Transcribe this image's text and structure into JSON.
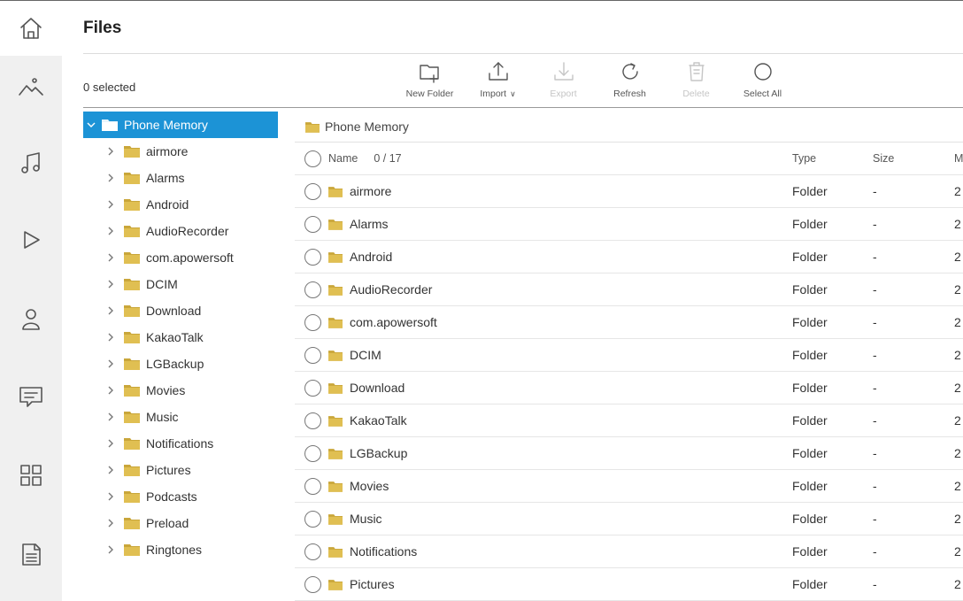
{
  "rail": [
    {
      "icon": "home-icon"
    },
    {
      "icon": "photos-icon"
    },
    {
      "icon": "music-icon"
    },
    {
      "icon": "video-icon"
    },
    {
      "icon": "contacts-icon"
    },
    {
      "icon": "messages-icon"
    },
    {
      "icon": "apps-icon"
    },
    {
      "icon": "files-icon"
    }
  ],
  "page": {
    "title": "Files",
    "selected": "0 selected"
  },
  "toolbar": {
    "new_folder": "New Folder",
    "import": "Import",
    "export": "Export",
    "refresh": "Refresh",
    "delete": "Delete",
    "select_all": "Select All"
  },
  "tree": {
    "root": "Phone Memory",
    "items": [
      "airmore",
      "Alarms",
      "Android",
      "AudioRecorder",
      "com.apowersoft",
      "DCIM",
      "Download",
      "KakaoTalk",
      "LGBackup",
      "Movies",
      "Music",
      "Notifications",
      "Pictures",
      "Podcasts",
      "Preload",
      "Ringtones"
    ]
  },
  "list": {
    "breadcrumb": "Phone Memory",
    "columns": {
      "name": "Name",
      "counter": "0 / 17",
      "type": "Type",
      "size": "Size",
      "modified": "M"
    },
    "rows": [
      {
        "name": "airmore",
        "type": "Folder",
        "size": "-",
        "modified": "2"
      },
      {
        "name": "Alarms",
        "type": "Folder",
        "size": "-",
        "modified": "2"
      },
      {
        "name": "Android",
        "type": "Folder",
        "size": "-",
        "modified": "2"
      },
      {
        "name": "AudioRecorder",
        "type": "Folder",
        "size": "-",
        "modified": "2"
      },
      {
        "name": "com.apowersoft",
        "type": "Folder",
        "size": "-",
        "modified": "2"
      },
      {
        "name": "DCIM",
        "type": "Folder",
        "size": "-",
        "modified": "2"
      },
      {
        "name": "Download",
        "type": "Folder",
        "size": "-",
        "modified": "2"
      },
      {
        "name": "KakaoTalk",
        "type": "Folder",
        "size": "-",
        "modified": "2"
      },
      {
        "name": "LGBackup",
        "type": "Folder",
        "size": "-",
        "modified": "2"
      },
      {
        "name": "Movies",
        "type": "Folder",
        "size": "-",
        "modified": "2"
      },
      {
        "name": "Music",
        "type": "Folder",
        "size": "-",
        "modified": "2"
      },
      {
        "name": "Notifications",
        "type": "Folder",
        "size": "-",
        "modified": "2"
      },
      {
        "name": "Pictures",
        "type": "Folder",
        "size": "-",
        "modified": "2"
      }
    ]
  },
  "colors": {
    "accent": "#1c93d6",
    "folder": "#e0bf52",
    "rail": "#f0f0f0"
  }
}
